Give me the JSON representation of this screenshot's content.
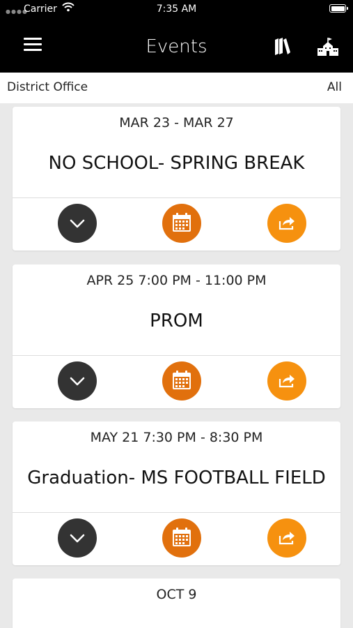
{
  "status_bar": {
    "carrier": "Carrier",
    "time": "7:35 AM"
  },
  "header": {
    "title": "Events"
  },
  "filter": {
    "location": "District Office",
    "category": "All"
  },
  "events": [
    {
      "date": "MAR 23 - MAR 27",
      "name": "NO SCHOOL- SPRING BREAK"
    },
    {
      "date": "APR 25 7:00 PM - 11:00 PM",
      "name": "PROM"
    },
    {
      "date": "MAY 21 7:30 PM - 8:30 PM",
      "name": "Graduation- MS FOOTBALL FIELD"
    },
    {
      "date": "OCT 9",
      "name": ""
    }
  ],
  "colors": {
    "header_bg": "#000000",
    "expand_button": "#333333",
    "calendar_button": "#e1700d",
    "share_button": "#f6910f",
    "background": "#e9e9e9"
  },
  "icons": {
    "menu": "hamburger-icon",
    "library": "books-icon",
    "school": "school-icon",
    "expand": "chevron-down-icon",
    "calendar": "calendar-icon",
    "share": "share-icon"
  }
}
